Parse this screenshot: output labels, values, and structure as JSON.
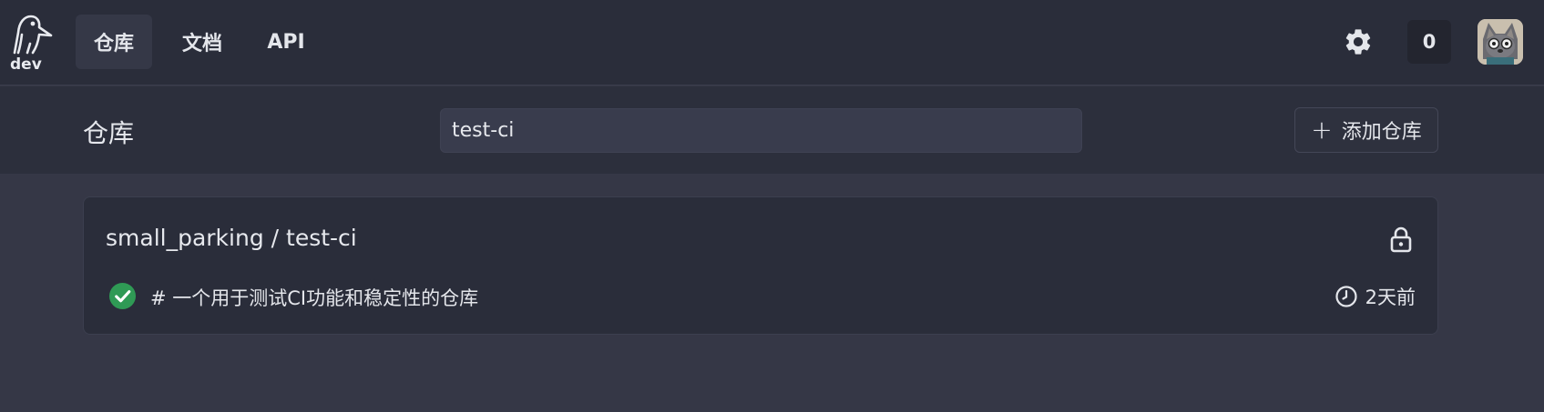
{
  "header": {
    "env_label": "dev",
    "nav": [
      {
        "label": "仓库",
        "active": true
      },
      {
        "label": "文档",
        "active": false
      },
      {
        "label": "API",
        "active": false
      }
    ],
    "notification_count": "0",
    "icons": {
      "settings": "gear-icon",
      "avatar": "user-avatar",
      "logo": "penguin-logo-icon"
    }
  },
  "page": {
    "title": "仓库",
    "search_value": "test-ci",
    "add_button_label": "添加仓库"
  },
  "repos": [
    {
      "full_name": "small_parking / test-ci",
      "description": "# 一个用于测试CI功能和稳定性的仓库",
      "updated": "2天前",
      "status": "success",
      "private": true
    }
  ],
  "colors": {
    "background": "#353746",
    "topbar": "#2a2d3a",
    "success": "#2f9a55"
  }
}
